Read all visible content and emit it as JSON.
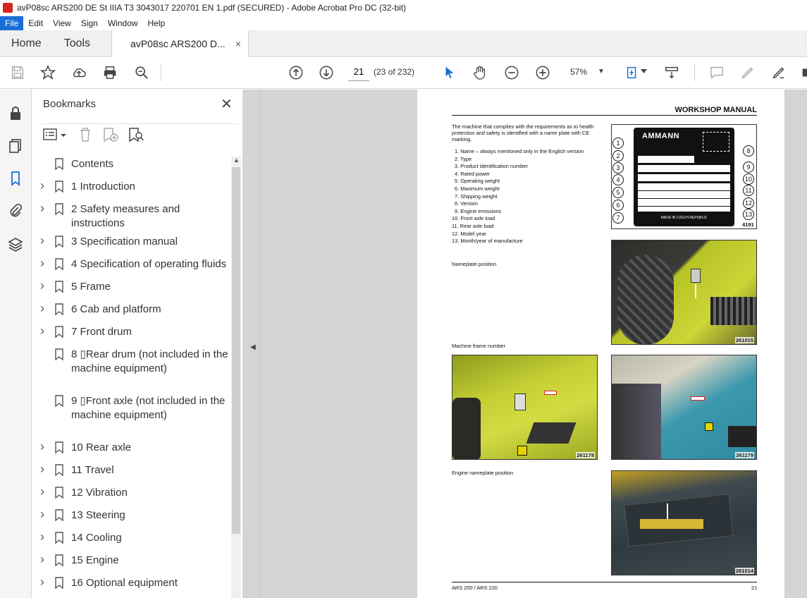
{
  "window": {
    "title": "avP08sc ARS200 DE St IIIA T3 3043017 220701 EN 1.pdf (SECURED) - Adobe Acrobat Pro DC (32-bit)"
  },
  "menu": [
    "File",
    "Edit",
    "View",
    "Sign",
    "Window",
    "Help"
  ],
  "tabs": {
    "home": "Home",
    "tools": "Tools",
    "document": "avP08sc ARS200 D...",
    "close": "×"
  },
  "toolbar": {
    "page_value": "21",
    "page_count": "(23 of 232)",
    "zoom": "57%"
  },
  "bookmarks": {
    "title": "Bookmarks",
    "close": "✕",
    "items": [
      {
        "label": "Contents",
        "expandable": false
      },
      {
        "label": "1 Introduction",
        "expandable": true
      },
      {
        "label": "2 Safety measures and instructions",
        "expandable": true
      },
      {
        "label": "3 Specification manual",
        "expandable": true
      },
      {
        "label": "4 Specification of operating fluids",
        "expandable": true
      },
      {
        "label": "5 Frame",
        "expandable": true
      },
      {
        "label": "6 Cab and platform",
        "expandable": true
      },
      {
        "label": "7 Front drum",
        "expandable": true
      },
      {
        "label": "8 ▯Rear drum (not included in the machine equipment)",
        "expandable": false
      },
      {
        "label": "9 ▯Front axle (not included in the machine equipment)",
        "expandable": false
      },
      {
        "label": "10 Rear axle",
        "expandable": true
      },
      {
        "label": "11 Travel",
        "expandable": true
      },
      {
        "label": "12 Vibration",
        "expandable": true
      },
      {
        "label": "13 Steering",
        "expandable": true
      },
      {
        "label": "14 Cooling",
        "expandable": true
      },
      {
        "label": "15 Engine",
        "expandable": true
      },
      {
        "label": "16 Optional equipment",
        "expandable": true
      }
    ]
  },
  "document": {
    "header": "WORKSHOP MANUAL",
    "intro": "The machine that complies with the requirements as to health protection and safety is identified with a name plate with CE marking.",
    "nameplate_list": [
      "1. Name – always mentioned only in the English version",
      "2. Type",
      "3. Product identification number",
      "4. Rated power",
      "5. Operating weight",
      "6. Maximum weight",
      "7. Shipping weight",
      "8. Version",
      "9. Engine emissions",
      "10. Front axle load",
      "11. Rear axle load",
      "12. Model year",
      "13. Month/year of manufacture"
    ],
    "captions": {
      "nameplate_position": "Nameplate position",
      "frame_number": "Machine frame number",
      "engine_nameplate": "Engine nameplate position"
    },
    "figure_numbers": {
      "plate": "4191",
      "photo1": "261015",
      "photo2": "261178",
      "photo3": "261179",
      "photo4": "261014"
    },
    "plate": {
      "brand": "AMMANN",
      "made": "MADE IN CZECH REPUBLIC"
    },
    "callouts_left": [
      "1",
      "2",
      "3",
      "4",
      "5",
      "6",
      "7"
    ],
    "callouts_right": [
      "8",
      "9",
      "10",
      "11",
      "12",
      "13"
    ],
    "footer_left": "ARS 200 / ARS 220",
    "footer_right": "21"
  },
  "colors": {
    "accent": "#1a6fd6",
    "pdf_red": "#d8261c",
    "machine_yellow": "#c7d22a",
    "machine_teal": "#3e9bb0"
  }
}
